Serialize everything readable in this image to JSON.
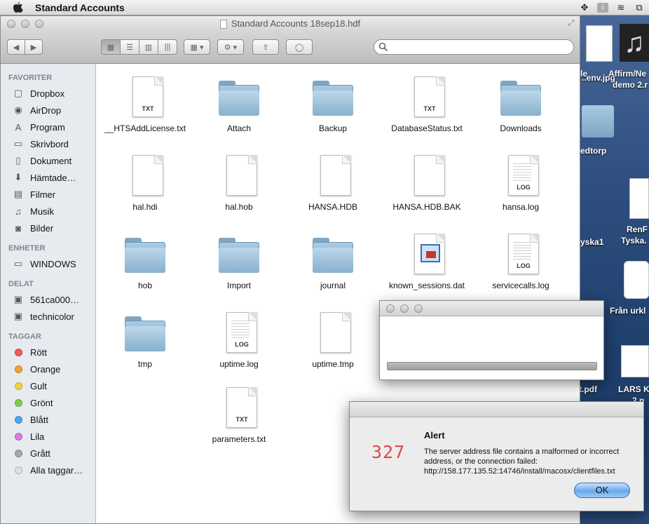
{
  "menubar": {
    "app_name": "Standard Accounts"
  },
  "window": {
    "title": "Standard Accounts 18sep18.hdf"
  },
  "sidebar": {
    "favorites_header": "FAVORITER",
    "favorites": [
      {
        "label": "Dropbox",
        "icon": "dropbox-icon"
      },
      {
        "label": "AirDrop",
        "icon": "airdrop-icon"
      },
      {
        "label": "Program",
        "icon": "applications-icon"
      },
      {
        "label": "Skrivbord",
        "icon": "desktop-icon"
      },
      {
        "label": "Dokument",
        "icon": "documents-icon"
      },
      {
        "label": "Hämtade…",
        "icon": "downloads-icon"
      },
      {
        "label": "Filmer",
        "icon": "movies-icon"
      },
      {
        "label": "Musik",
        "icon": "music-icon"
      },
      {
        "label": "Bilder",
        "icon": "pictures-icon"
      }
    ],
    "devices_header": "ENHETER",
    "devices": [
      {
        "label": "WINDOWS",
        "icon": "disk-icon"
      }
    ],
    "shared_header": "DELAT",
    "shared": [
      {
        "label": "561ca000…",
        "icon": "computer-icon"
      },
      {
        "label": "technicolor",
        "icon": "computer-icon"
      }
    ],
    "tags_header": "TAGGAR",
    "tags": [
      {
        "label": "Rött",
        "color": "#f05a5a"
      },
      {
        "label": "Orange",
        "color": "#f5a030"
      },
      {
        "label": "Gult",
        "color": "#ecd83a"
      },
      {
        "label": "Grönt",
        "color": "#7ccf46"
      },
      {
        "label": "Blått",
        "color": "#4aa8f0"
      },
      {
        "label": "Lila",
        "color": "#d97ee0"
      },
      {
        "label": "Grått",
        "color": "#a8a8a8"
      },
      {
        "label": "Alla taggar…",
        "color": "#e0e0e0"
      }
    ]
  },
  "files": [
    {
      "name": "__HTSAddLicense.txt",
      "kind": "doc",
      "ext": "TXT"
    },
    {
      "name": "Attach",
      "kind": "folder"
    },
    {
      "name": "Backup",
      "kind": "folder"
    },
    {
      "name": "DatabaseStatus.txt",
      "kind": "doc",
      "ext": "TXT"
    },
    {
      "name": "Downloads",
      "kind": "folder"
    },
    {
      "name": "hal.hdi",
      "kind": "doc",
      "ext": ""
    },
    {
      "name": "hal.hob",
      "kind": "doc",
      "ext": ""
    },
    {
      "name": "HANSA.HDB",
      "kind": "doc",
      "ext": ""
    },
    {
      "name": "HANSA.HDB.BAK",
      "kind": "doc",
      "ext": ""
    },
    {
      "name": "hansa.log",
      "kind": "log",
      "ext": "LOG"
    },
    {
      "name": "hob",
      "kind": "folder"
    },
    {
      "name": "Import",
      "kind": "folder"
    },
    {
      "name": "journal",
      "kind": "folder"
    },
    {
      "name": "known_sessions.dat",
      "kind": "app"
    },
    {
      "name": "servicecalls.log",
      "kind": "log",
      "ext": "LOG"
    },
    {
      "name": "tmp",
      "kind": "folder"
    },
    {
      "name": "uptime.log",
      "kind": "log",
      "ext": "LOG"
    },
    {
      "name": "uptime.tmp",
      "kind": "doc",
      "ext": ""
    },
    {
      "name": "parameters.txt",
      "kind": "doc",
      "ext": "TXT"
    }
  ],
  "desktop": {
    "labels": [
      "le",
      "..env.jpg",
      "Affirm/Ne",
      "demo 2.r",
      "edtorp",
      "yska1",
      "RenF",
      "Tyska.",
      "Från urkl",
      "t.pdf",
      "LARS K",
      "2 n"
    ]
  },
  "progress": {
    "value": 1.0
  },
  "alert": {
    "icon_text": "327",
    "heading": "Alert",
    "message": "The server address file contains a malformed or incorrect address, or the connection failed:  http://158.177.135.52:14746/install/macosx/clientfiles.txt",
    "ok_label": "OK"
  }
}
